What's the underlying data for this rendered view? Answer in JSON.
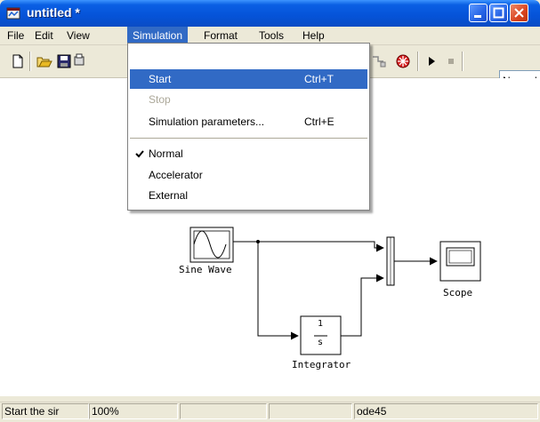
{
  "window": {
    "title": "untitled *"
  },
  "menubar": {
    "items": [
      {
        "label": "File"
      },
      {
        "label": "Edit"
      },
      {
        "label": "View"
      },
      {
        "label": "Simulation"
      },
      {
        "label": "Format"
      },
      {
        "label": "Tools"
      },
      {
        "label": "Help"
      }
    ]
  },
  "simulation_menu": {
    "items": [
      {
        "label": "Start",
        "shortcut": "Ctrl+T"
      },
      {
        "label": "Stop",
        "shortcut": ""
      },
      {
        "label": "Simulation parameters...",
        "shortcut": "Ctrl+E"
      },
      {
        "label": "Normal",
        "checked": true
      },
      {
        "label": "Accelerator"
      },
      {
        "label": "External"
      }
    ]
  },
  "toolbar": {
    "icons": [
      "new-icon",
      "open-icon",
      "save-icon",
      "print-icon",
      "library-icon",
      "debug-icon",
      "start-icon",
      "stop-icon"
    ],
    "mode_value": "Normal"
  },
  "diagram": {
    "blocks": {
      "sine_wave": "Sine Wave",
      "integrator": "Integrator",
      "integrator_numerator": "1",
      "integrator_denominator": "s",
      "scope": "Scope"
    }
  },
  "statusbar": {
    "message": "Start the sir",
    "zoom": "100%",
    "solver": "ode45"
  },
  "colors": {
    "titlebar": "#0553d8",
    "highlight": "#316ac5",
    "close": "#d9431e"
  }
}
